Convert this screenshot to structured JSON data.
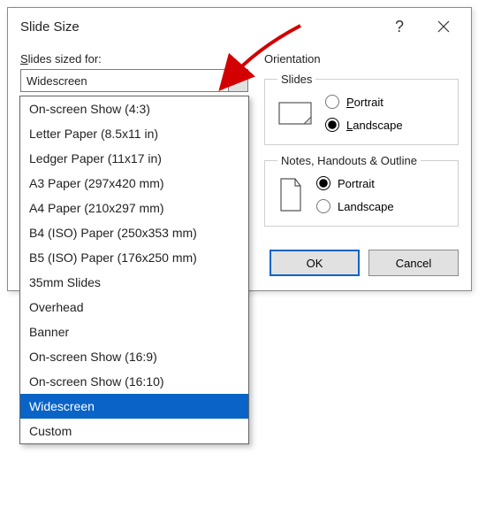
{
  "dialog": {
    "title": "Slide Size",
    "help": "?",
    "close": "×"
  },
  "left": {
    "label_prefix": "S",
    "label_rest": "lides sized for:",
    "combo_value": "Widescreen"
  },
  "dropdown_items": [
    "On-screen Show (4:3)",
    "Letter Paper (8.5x11 in)",
    "Ledger Paper (11x17 in)",
    "A3 Paper (297x420 mm)",
    "A4 Paper (210x297 mm)",
    "B4 (ISO) Paper (250x353 mm)",
    "B5 (ISO) Paper (176x250 mm)",
    "35mm Slides",
    "Overhead",
    "Banner",
    "On-screen Show (16:9)",
    "On-screen Show (16:10)",
    "Widescreen",
    "Custom"
  ],
  "dropdown_selected_index": 12,
  "orientation": {
    "label": "Orientation",
    "slides": {
      "legend": "Slides",
      "portrait_u": "P",
      "portrait_rest": "ortrait",
      "landscape_u": "L",
      "landscape_rest": "andscape",
      "selected": "landscape"
    },
    "notes": {
      "legend": "Notes, Handouts & Outline",
      "portrait_u": "P",
      "portrait_rest": "ortrait",
      "landscape_u": "L",
      "landscape_rest": "andscape",
      "selected": "portrait"
    }
  },
  "buttons": {
    "ok": "OK",
    "cancel": "Cancel"
  }
}
